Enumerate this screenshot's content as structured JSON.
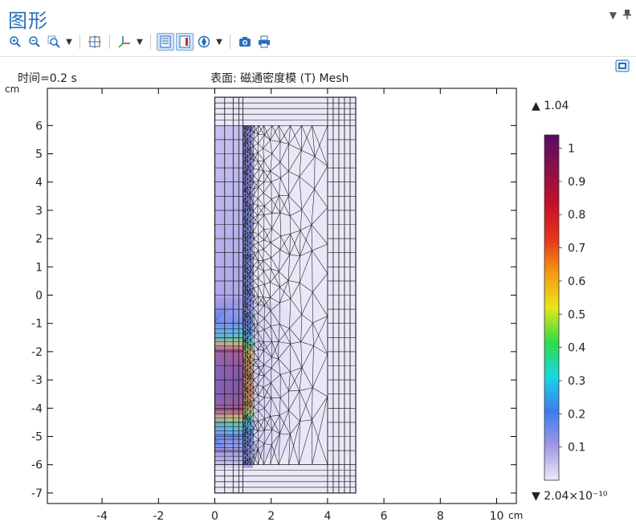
{
  "window": {
    "title": "图形"
  },
  "toolbar": {
    "icons": [
      "zoom-in-icon",
      "zoom-out-icon",
      "zoom-box-icon",
      "zoom-extents-icon",
      "axis-orientation-icon",
      "grid-toggle-icon",
      "legend-toggle-icon",
      "scene-light-icon",
      "camera-icon",
      "print-icon"
    ]
  },
  "plot": {
    "time_label": "时间=0.2 s",
    "title": "表面: 磁通密度模 (T) Mesh",
    "unit_y": "cm",
    "unit_x": "cm",
    "colorbar_max_label": "▲ 1.04",
    "colorbar_min_label": "▼ 2.04×10⁻¹⁰"
  },
  "chart_data": {
    "type": "heatmap",
    "title": "表面: 磁通密度模 (T) Mesh",
    "subtitle": "时间=0.2 s",
    "xlabel": "cm",
    "ylabel": "cm",
    "xlim": [
      -6,
      11
    ],
    "ylim": [
      -7.3,
      7.3
    ],
    "x_ticks": [
      -4,
      -2,
      0,
      2,
      4,
      6,
      8,
      10
    ],
    "y_ticks": [
      6,
      5,
      4,
      3,
      2,
      1,
      0,
      -1,
      -2,
      -3,
      -4,
      -5,
      -6,
      -7
    ],
    "grid": false,
    "colorbar": {
      "min": 2.04e-10,
      "max": 1.04,
      "ticks": [
        1,
        0.9,
        0.8,
        0.7,
        0.6,
        0.5,
        0.4,
        0.3,
        0.2,
        0.1
      ],
      "colormap": "Rainbow (purple-red-orange-yellow-green-cyan-blue-lavender)"
    },
    "domain": {
      "x": [
        0,
        5
      ],
      "y": [
        -7,
        7
      ]
    },
    "magnet_region": {
      "x": [
        0,
        1
      ],
      "y": [
        -6,
        6
      ]
    },
    "field_profile": {
      "y": [
        6,
        0,
        -0.5,
        -1,
        -1.5,
        -1.8,
        -2,
        -2.5,
        -3,
        -3.5,
        -4,
        -4.3,
        -4.6,
        -5,
        -5.5,
        -6
      ],
      "magnitude": [
        0.05,
        0.08,
        0.12,
        0.2,
        0.35,
        0.6,
        0.85,
        0.95,
        1.0,
        0.98,
        0.88,
        0.55,
        0.35,
        0.2,
        0.1,
        0.05
      ]
    }
  }
}
